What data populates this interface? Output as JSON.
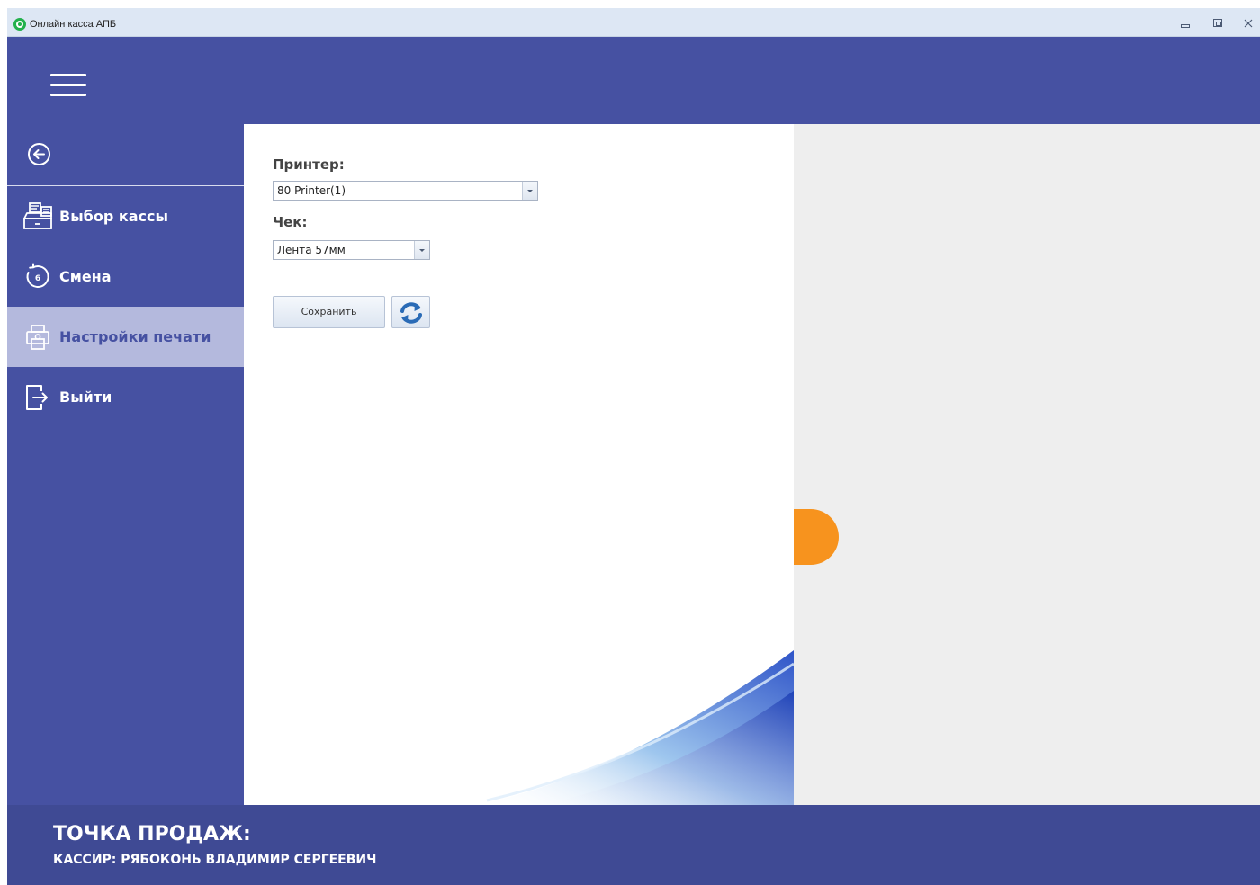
{
  "window": {
    "title": "Онлайн касса АПБ",
    "icon": "app-logo-icon",
    "controls": [
      "minimize-icon",
      "maximize-icon",
      "close-icon"
    ]
  },
  "header": {
    "menu_icon": "hamburger-menu-icon",
    "color": "#4651a2"
  },
  "sidebar": {
    "back_icon": "arrow-left-circle-icon",
    "items": [
      {
        "label": "Выбор кассы",
        "icon": "cash-register-icon",
        "active": false
      },
      {
        "label": "Смена",
        "icon": "clock-cycle-icon",
        "active": false
      },
      {
        "label": "Настройки печати",
        "icon": "printer-icon",
        "active": true
      },
      {
        "label": "Выйти",
        "icon": "logout-icon",
        "active": false
      }
    ],
    "active_color": "#b4b9dd"
  },
  "print_settings": {
    "printer_label": "Принтер:",
    "printer_value": "80 Printer(1)",
    "receipt_label": "Чек:",
    "receipt_value": "Лента 57мм",
    "save_label": "Сохранить",
    "refresh_icon": "refresh-icon"
  },
  "side_tab": {
    "color": "#f7931e"
  },
  "footer": {
    "sales_point": "ТОЧКА ПРОДАЖ:",
    "cashier": "КАССИР: РЯБОКОНЬ ВЛАДИМИР СЕРГЕЕВИЧ"
  }
}
